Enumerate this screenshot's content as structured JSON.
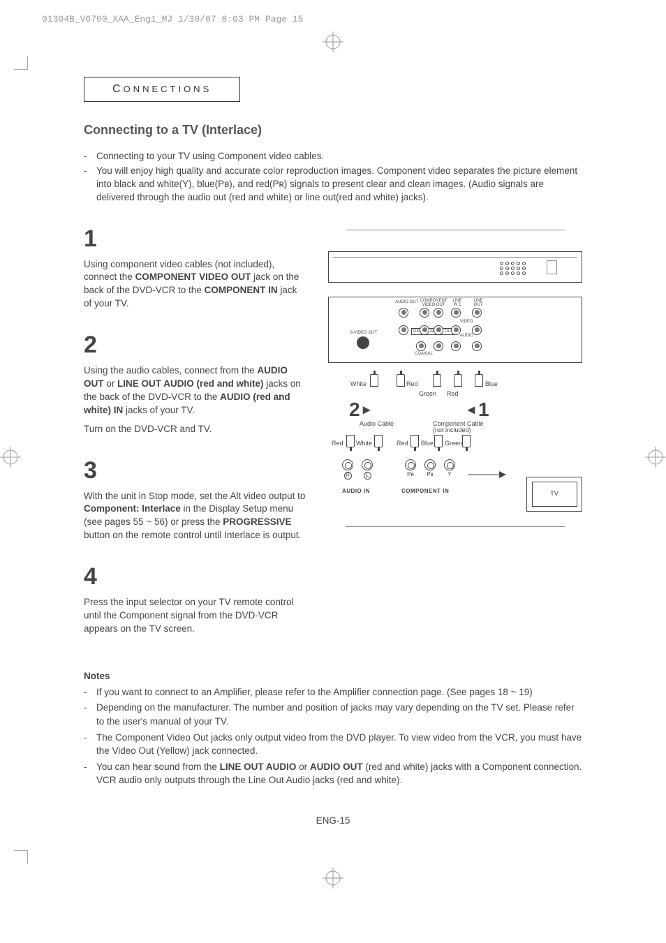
{
  "print_header": "01304B_V6700_XAA_Eng1_MJ  1/30/07  8:03 PM  Page 15",
  "section_label_cap": "C",
  "section_label_rest": "ONNECTIONS",
  "title": "Connecting to a TV (Interlace)",
  "intro_items": [
    "Connecting to your TV using Component video cables.",
    "You will enjoy high quality and accurate color reproduction images. Component video separates the picture element into black and white(Y), blue(Pʙ), and red(Pʀ) signals to present clear and clean images. (Audio signals are delivered through the audio out (red and white) or line out(red and white) jacks)."
  ],
  "steps": {
    "s1": {
      "num": "1",
      "text_before": "Using component video cables (not included), connect the ",
      "b1": "COMPONENT VIDEO OUT",
      "text_mid1": " jack on the back of the DVD-VCR to the ",
      "b2": "COMPONENT IN",
      "text_after": " jack of your TV."
    },
    "s2": {
      "num": "2",
      "text_before": "Using the audio cables, connect from the ",
      "b1": "AUDIO OUT",
      "text_mid1": " or ",
      "b2": "LINE OUT AUDIO (red and white)",
      "text_mid2": "  jacks on the back of the DVD-VCR to the ",
      "b3": "AUDIO (red and white) IN",
      "text_after": " jacks of your TV.",
      "text_extra": "Turn on the DVD-VCR and TV."
    },
    "s3": {
      "num": "3",
      "text_before": "With the unit in Stop mode, set the Alt video output to ",
      "b1": "Component: Interlace",
      "text_mid1": " in the Display Setup menu (see pages 55 ~ 56) or press the ",
      "b2": "PROGRESSIVE",
      "text_after": " button on the remote control until Interlace is output."
    },
    "s4": {
      "num": "4",
      "text": "Press the input selector on your TV remote control until the Component signal from the DVD-VCR appears on the TV screen."
    }
  },
  "notes_head": "Notes",
  "notes": [
    "If you want to connect to an Amplifier, please refer to the Amplifier connection page. (See pages 18 ~ 19)",
    "Depending on the manufacturer. The number and position of jacks may vary depending on the TV set. Please refer to the user's manual of your TV.",
    "The Component Video Out jacks only output video from the DVD player. To view video from the VCR, you must have the Video Out (Yellow) jack connected."
  ],
  "note4_before": "You can hear sound from the ",
  "note4_b1": "LINE OUT AUDIO",
  "note4_mid": " or ",
  "note4_b2": "AUDIO OUT",
  "note4_after": " (red and white) jacks with a Component connection. VCR audio only outputs through the Line Out Audio jacks (red and white).",
  "page_num": "ENG-15",
  "diagram": {
    "audio_out": "AUDIO OUT",
    "component_video_out": "COMPONENT VIDEO OUT",
    "line_in1": "LINE IN 1",
    "line_out": "LINE OUT",
    "video": "VIDEO",
    "svideo": "S-VIDEO OUT",
    "digital_audio_out": "DIGITAL AUDIO OUT",
    "audio": "AUDIO",
    "coaxial": "COAXIAL",
    "white": "White",
    "red": "Red",
    "green": "Green",
    "blue": "Blue",
    "num2": "2",
    "num1": "1",
    "audio_cable": "Audio Cable",
    "component_cable": "Component Cable (not included)",
    "tv": "TV",
    "audio_in": "AUDIO IN",
    "component_in": "COMPONENT IN",
    "R": "R",
    "L": "L",
    "Pr": "Pʀ",
    "Pb": "Pʙ",
    "Y": "Y"
  }
}
